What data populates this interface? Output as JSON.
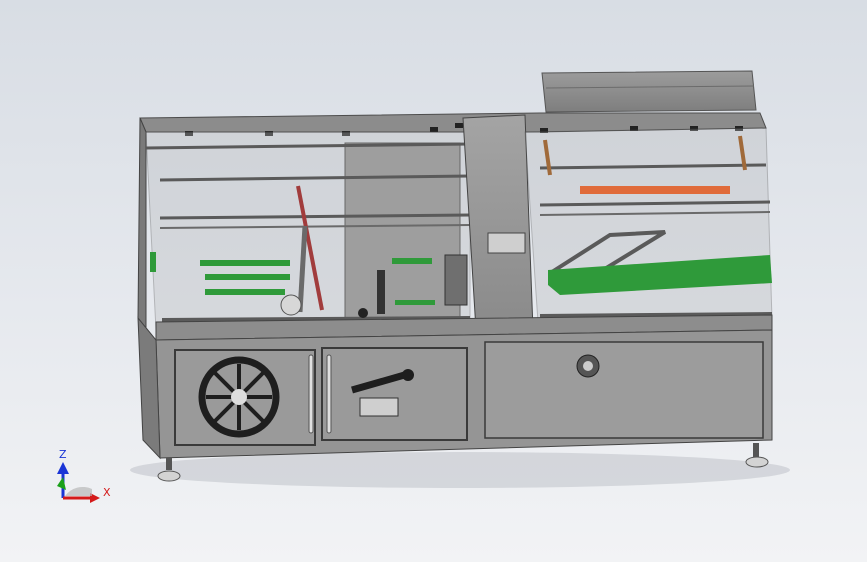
{
  "window": {
    "title": ""
  },
  "model": {
    "description": ""
  },
  "triad": {
    "z_label": "Z",
    "x_label": "X",
    "z_color": "#1a35d6",
    "x_color": "#d41a1a",
    "y_color": "#1aa01a"
  },
  "colors": {
    "background_top": "#d8dde4",
    "background_bottom": "#f2f3f5",
    "frame": "#8e8e8e",
    "frame_dark": "#5a5a5a",
    "panel": "#9a9a9a",
    "accent_green": "#2f9a3a",
    "accent_orange": "#e06b3a"
  }
}
